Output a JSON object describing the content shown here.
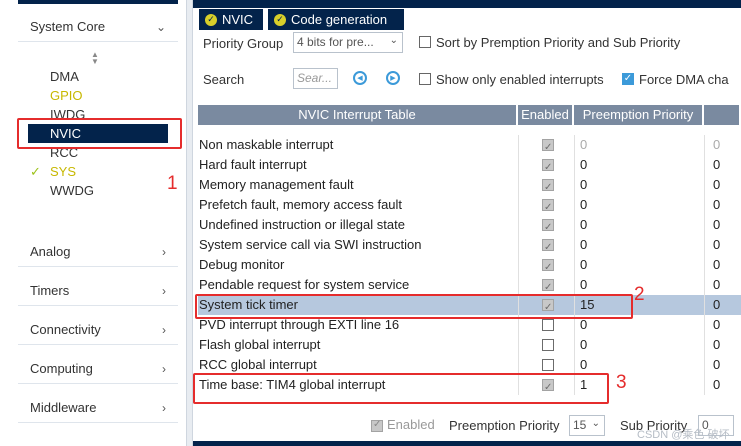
{
  "sidebar": {
    "category": "System Core",
    "items": [
      {
        "label": "DMA",
        "state": "normal",
        "check": ""
      },
      {
        "label": "GPIO",
        "state": "warn",
        "check": ""
      },
      {
        "label": "IWDG",
        "state": "normal",
        "check": ""
      },
      {
        "label": "NVIC",
        "state": "selected",
        "check": ""
      },
      {
        "label": "RCC",
        "state": "normal",
        "check": ""
      },
      {
        "label": "SYS",
        "state": "ok",
        "check": "✓"
      },
      {
        "label": "WWDG",
        "state": "normal",
        "check": ""
      }
    ],
    "categories": [
      "Analog",
      "Timers",
      "Connectivity",
      "Computing",
      "Middleware"
    ]
  },
  "annotations": [
    "1",
    "2",
    "3"
  ],
  "tabs": [
    {
      "label": "NVIC",
      "icon": "check-circle-icon"
    },
    {
      "label": "Code generation",
      "icon": "check-circle-icon"
    }
  ],
  "controls": {
    "priority_group_label": "Priority Group",
    "priority_group_value": "4 bits for pre...",
    "sort_label": "Sort by Premption Priority and Sub Priority",
    "search_label": "Search",
    "search_placeholder": "Sear...",
    "only_enabled_label": "Show only enabled interrupts",
    "force_dma_label": "Force DMA cha"
  },
  "table": {
    "headers": [
      "NVIC Interrupt Table",
      "Enabled",
      "Preemption Priority",
      ""
    ],
    "rows": [
      {
        "name": "Non maskable interrupt",
        "enabled": true,
        "preemption": "0",
        "sub": "0",
        "locked": true
      },
      {
        "name": "Hard fault interrupt",
        "enabled": true,
        "preemption": "0",
        "sub": "0",
        "locked": false
      },
      {
        "name": "Memory management fault",
        "enabled": true,
        "preemption": "0",
        "sub": "0",
        "locked": false
      },
      {
        "name": "Prefetch fault, memory access fault",
        "enabled": true,
        "preemption": "0",
        "sub": "0",
        "locked": false
      },
      {
        "name": "Undefined instruction or illegal state",
        "enabled": true,
        "preemption": "0",
        "sub": "0",
        "locked": false
      },
      {
        "name": "System service call via SWI instruction",
        "enabled": true,
        "preemption": "0",
        "sub": "0",
        "locked": false
      },
      {
        "name": "Debug monitor",
        "enabled": true,
        "preemption": "0",
        "sub": "0",
        "locked": false
      },
      {
        "name": "Pendable request for system service",
        "enabled": true,
        "preemption": "0",
        "sub": "0",
        "locked": false
      },
      {
        "name": "System tick timer",
        "enabled": true,
        "preemption": "15",
        "sub": "0",
        "locked": false
      },
      {
        "name": "PVD interrupt through EXTI line 16",
        "enabled": false,
        "preemption": "0",
        "sub": "0",
        "locked": false
      },
      {
        "name": "Flash global interrupt",
        "enabled": false,
        "preemption": "0",
        "sub": "0",
        "locked": false
      },
      {
        "name": "RCC global interrupt",
        "enabled": false,
        "preemption": "0",
        "sub": "0",
        "locked": false
      },
      {
        "name": "Time base: TIM4 global interrupt",
        "enabled": true,
        "preemption": "1",
        "sub": "0",
        "locked": false
      }
    ]
  },
  "footer": {
    "enabled_label": "Enabled",
    "preemption_label": "Preemption Priority",
    "preemption_value": "15",
    "sub_label": "Sub Priority",
    "sub_value": "0"
  },
  "watermark": "CSDN @乘色 破坏",
  "colors": {
    "navy": "#03234b",
    "header_grey": "#7a8aa0",
    "highlight": "#b6c8de",
    "annotation_red": "#e52c2c",
    "accent_blue": "#3c9ad9",
    "warn_yellow": "#c7b800"
  }
}
